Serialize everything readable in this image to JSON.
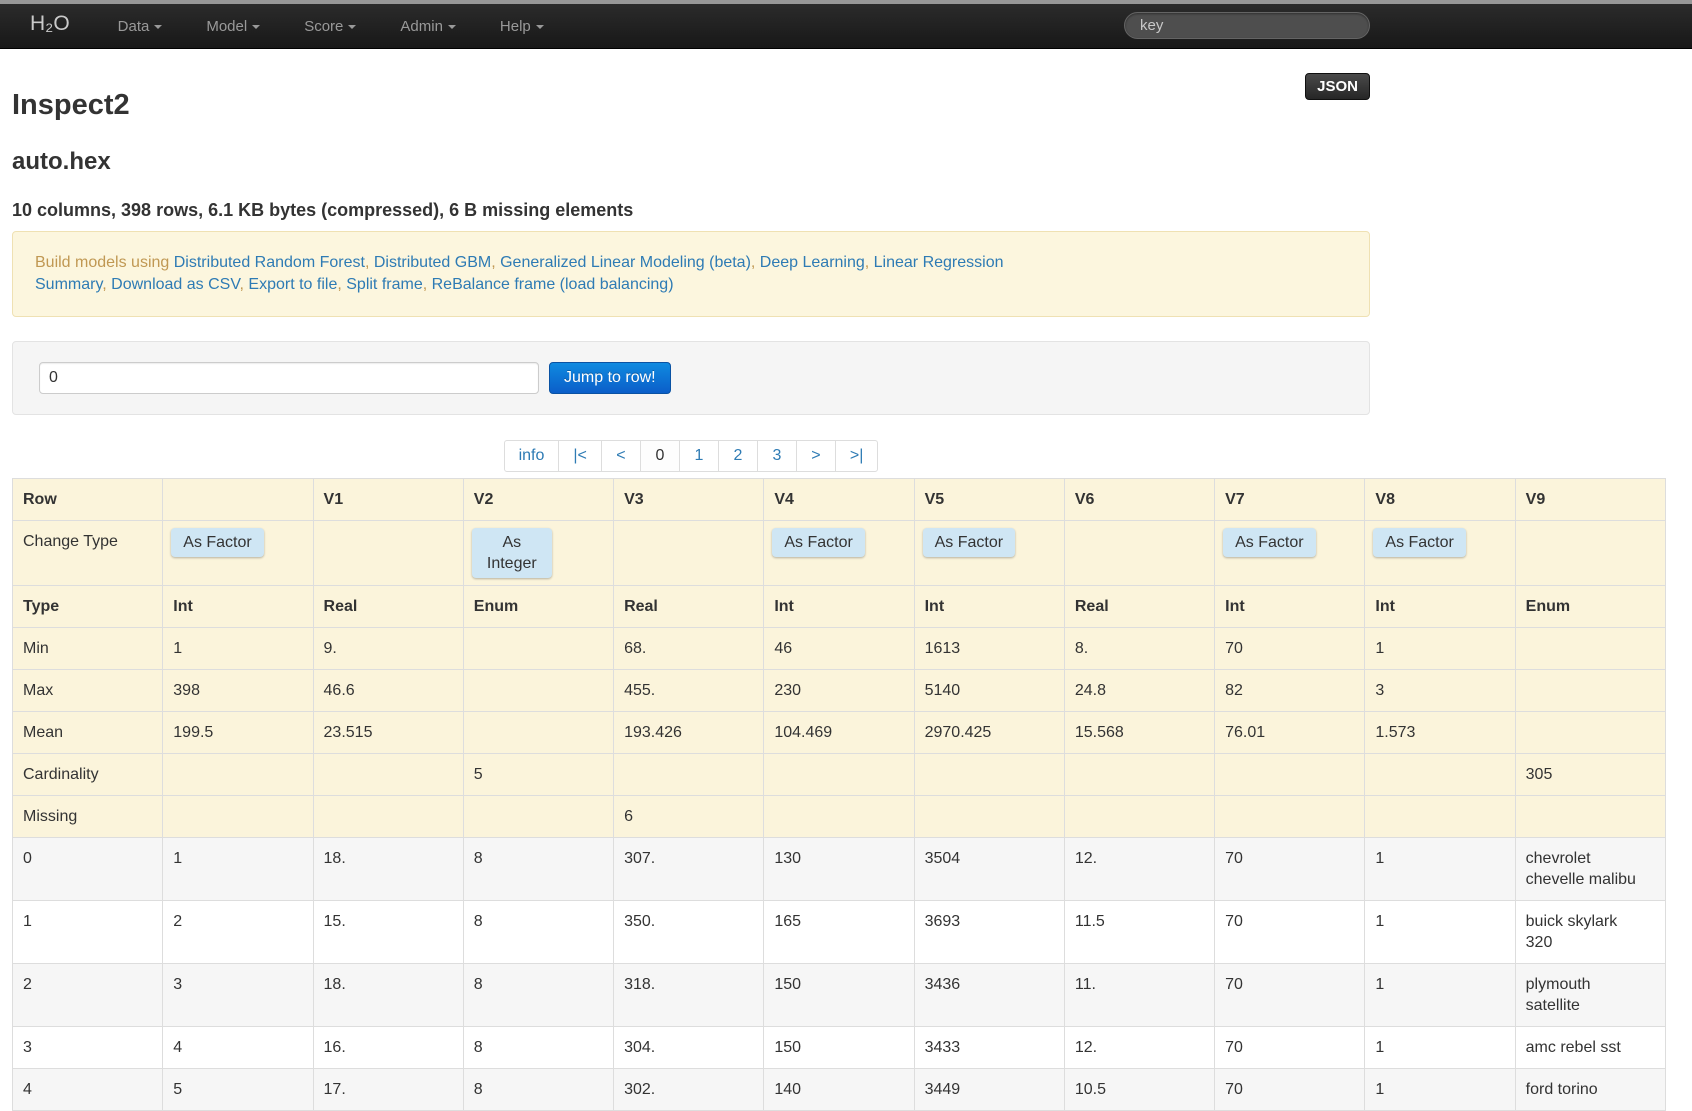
{
  "navbar": {
    "brand": "H₂O",
    "menus": [
      "Data",
      "Model",
      "Score",
      "Admin",
      "Help"
    ],
    "search": {
      "placeholder": "key"
    }
  },
  "header": {
    "json_button_label": "JSON",
    "title": "Inspect2",
    "frame_name": "auto.hex",
    "summary": "10 columns, 398 rows, 6.1 KB bytes (compressed), 6 B missing elements"
  },
  "build_bar": {
    "prefix": "Build models using",
    "model_links": [
      "Distributed Random Forest",
      "Distributed GBM",
      "Generalized Linear Modeling (beta)",
      "Deep Learning",
      "Linear Regression"
    ],
    "action_links": [
      "Summary",
      "Download as CSV",
      "Export to file",
      "Split frame",
      "ReBalance frame (load balancing)"
    ]
  },
  "jump_row": {
    "input_value": "0",
    "button_label": "Jump to row!"
  },
  "pagination": {
    "items": [
      {
        "label": "info",
        "active": false
      },
      {
        "label": "|<",
        "active": false
      },
      {
        "label": "<",
        "active": false
      },
      {
        "label": "0",
        "active": true
      },
      {
        "label": "1",
        "active": false
      },
      {
        "label": "2",
        "active": false
      },
      {
        "label": "3",
        "active": false
      },
      {
        "label": ">",
        "active": false
      },
      {
        "label": ">|",
        "active": false
      }
    ]
  },
  "table": {
    "corner_header": "Row",
    "column_headers": [
      "",
      "V1",
      "V2",
      "V3",
      "V4",
      "V5",
      "V6",
      "V7",
      "V8",
      "V9"
    ],
    "change_type": {
      "row_label": "Change Type",
      "buttons": [
        "As Factor",
        "",
        "As Integer",
        "",
        "As Factor",
        "As Factor",
        "",
        "As Factor",
        "As Factor",
        ""
      ]
    },
    "stat_rows": [
      {
        "label": "Type",
        "cells": [
          "Int",
          "Real",
          "Enum",
          "Real",
          "Int",
          "Int",
          "Real",
          "Int",
          "Int",
          "Enum"
        ]
      },
      {
        "label": "Min",
        "cells": [
          "1",
          "9.",
          "",
          "68.",
          "46",
          "1613",
          "8.",
          "70",
          "1",
          ""
        ]
      },
      {
        "label": "Max",
        "cells": [
          "398",
          "46.6",
          "",
          "455.",
          "230",
          "5140",
          "24.8",
          "82",
          "3",
          ""
        ]
      },
      {
        "label": "Mean",
        "cells": [
          "199.5",
          "23.515",
          "",
          "193.426",
          "104.469",
          "2970.425",
          "15.568",
          "76.01",
          "1.573",
          ""
        ]
      },
      {
        "label": "Cardinality",
        "cells": [
          "",
          "",
          "5",
          "",
          "",
          "",
          "",
          "",
          "",
          "305"
        ]
      },
      {
        "label": "Missing",
        "cells": [
          "",
          "",
          "",
          "6",
          "",
          "",
          "",
          "",
          "",
          ""
        ]
      }
    ],
    "data_rows": [
      {
        "label": "0",
        "cells": [
          "1",
          "18.",
          "8",
          "307.",
          "130",
          "3504",
          "12.",
          "70",
          "1",
          "chevrolet chevelle malibu"
        ]
      },
      {
        "label": "1",
        "cells": [
          "2",
          "15.",
          "8",
          "350.",
          "165",
          "3693",
          "11.5",
          "70",
          "1",
          "buick skylark 320"
        ]
      },
      {
        "label": "2",
        "cells": [
          "3",
          "18.",
          "8",
          "318.",
          "150",
          "3436",
          "11.",
          "70",
          "1",
          "plymouth satellite"
        ]
      },
      {
        "label": "3",
        "cells": [
          "4",
          "16.",
          "8",
          "304.",
          "150",
          "3433",
          "12.",
          "70",
          "1",
          "amc rebel sst"
        ]
      },
      {
        "label": "4",
        "cells": [
          "5",
          "17.",
          "8",
          "302.",
          "140",
          "3449",
          "10.5",
          "70",
          "1",
          "ford torino"
        ]
      }
    ]
  },
  "colors": {
    "link_blue": "#2e7bb4",
    "alert_text_tan": "#c09853",
    "table_stat_cream": "#fbf4db",
    "change_type_button_blue": "#cfe6f4",
    "primary_button_blue": "#0b6fd4",
    "navbar_bg": "#1f1f1f"
  }
}
